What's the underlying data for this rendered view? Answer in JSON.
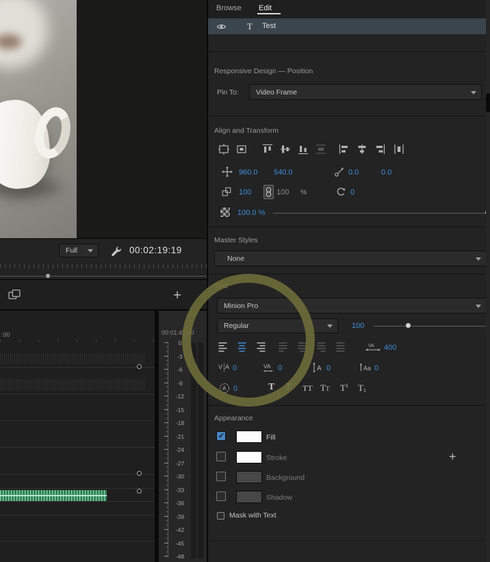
{
  "colors": {
    "accent_blue": "#3f8dd9",
    "annotation_circle": "rgba(112,110,58,0.88)",
    "waveform_green": "#2f7a55"
  },
  "monitor": {
    "zoom": "Full",
    "timecode": "00:02:19:19",
    "add_button": "+"
  },
  "timeline": {
    "ruler_start": ":00",
    "ruler_mark": "00:01:45:00"
  },
  "audio_meter": {
    "scale": [
      "0",
      "-3",
      "-6",
      "-9",
      "-12",
      "-15",
      "-18",
      "-21",
      "-24",
      "-27",
      "-30",
      "-33",
      "-36",
      "-39",
      "-42",
      "-45",
      "-48"
    ]
  },
  "esg": {
    "tabs": {
      "browse": "Browse",
      "edit": "Edit"
    },
    "layer": {
      "type_glyph": "T",
      "name": "Test"
    },
    "responsive": {
      "title": "Responsive Design — Position",
      "pin_label": "Pin To:",
      "pin_value": "Video Frame"
    },
    "transform": {
      "title": "Align and Transform",
      "pos_x": "960.0",
      "pos_y": "540.0",
      "anchor_x": "0.0",
      "anchor_y": "0.0",
      "scale_x": "100",
      "scale_y": "100",
      "unit": "%",
      "rotation": "0",
      "opacity": "100.0 %"
    },
    "master_styles": {
      "title": "Master Styles",
      "value": "None"
    },
    "text": {
      "title": "Text",
      "font": "Minion Pro",
      "style": "Regular",
      "size": "100",
      "tracking": "400",
      "kerning": "0",
      "tracking_alt": "0",
      "leading": "0",
      "baseline_shift": "0",
      "tsume": "0",
      "bold_label": "T",
      "italic_label": "T",
      "caps_label": "TT",
      "smallcaps_a": "T",
      "smallcaps_b": "T",
      "super_a": "T",
      "super_b": "1",
      "sub_a": "T",
      "sub_b": "1"
    },
    "appearance": {
      "title": "Appearance",
      "fill": "Fill",
      "stroke": "Stroke",
      "background": "Background",
      "shadow": "Shadow",
      "mask": "Mask with Text",
      "add_button": "+"
    }
  }
}
